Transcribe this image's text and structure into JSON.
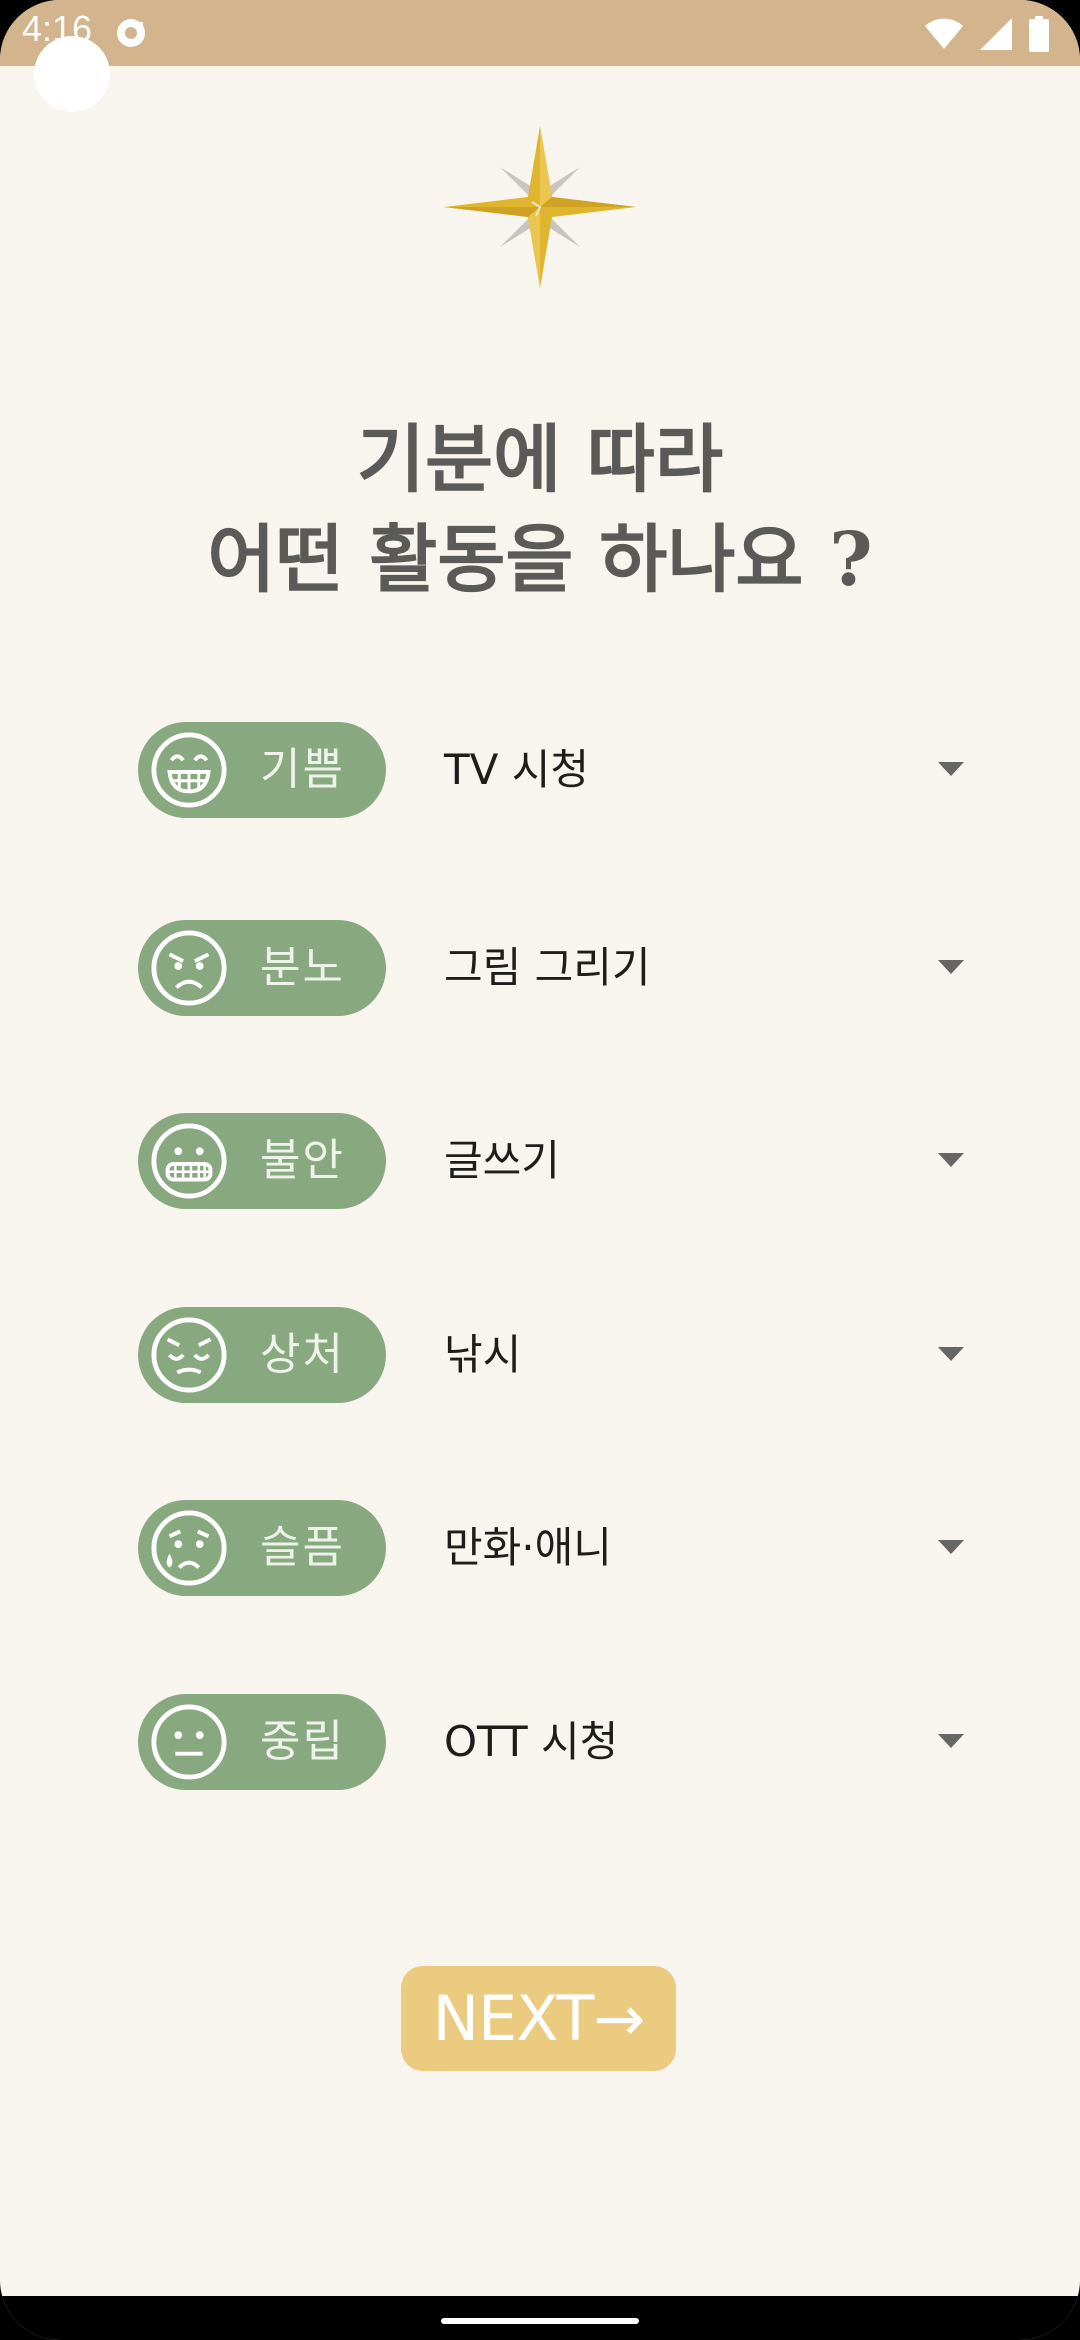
{
  "status_bar": {
    "time": "4:16",
    "icons": [
      "sync-icon",
      "wifi-icon",
      "signal-icon",
      "battery-icon"
    ]
  },
  "colors": {
    "status_bar": "#d3b48c",
    "background": "#f8f4ee",
    "emotion_pill": "#88a97f",
    "next_button": "#ebcb7f",
    "logo_gold": "#e0b52e"
  },
  "headline": {
    "line1": "기분에 따라",
    "line2": "어떤 활동을 하나요 ?"
  },
  "emotions": [
    {
      "label": "기쁨",
      "face_icon": "grinning-face-icon",
      "activity": "TV 시청"
    },
    {
      "label": "분노",
      "face_icon": "angry-face-icon",
      "activity": "그림 그리기"
    },
    {
      "label": "불안",
      "face_icon": "grimacing-face-icon",
      "activity": "글쓰기"
    },
    {
      "label": "상처",
      "face_icon": "pensive-face-icon",
      "activity": "낚시"
    },
    {
      "label": "슬픔",
      "face_icon": "crying-face-icon",
      "activity": "만화·애니"
    },
    {
      "label": "중립",
      "face_icon": "neutral-face-icon",
      "activity": "OTT 시청"
    }
  ],
  "next_button": {
    "label": "NEXT→"
  }
}
